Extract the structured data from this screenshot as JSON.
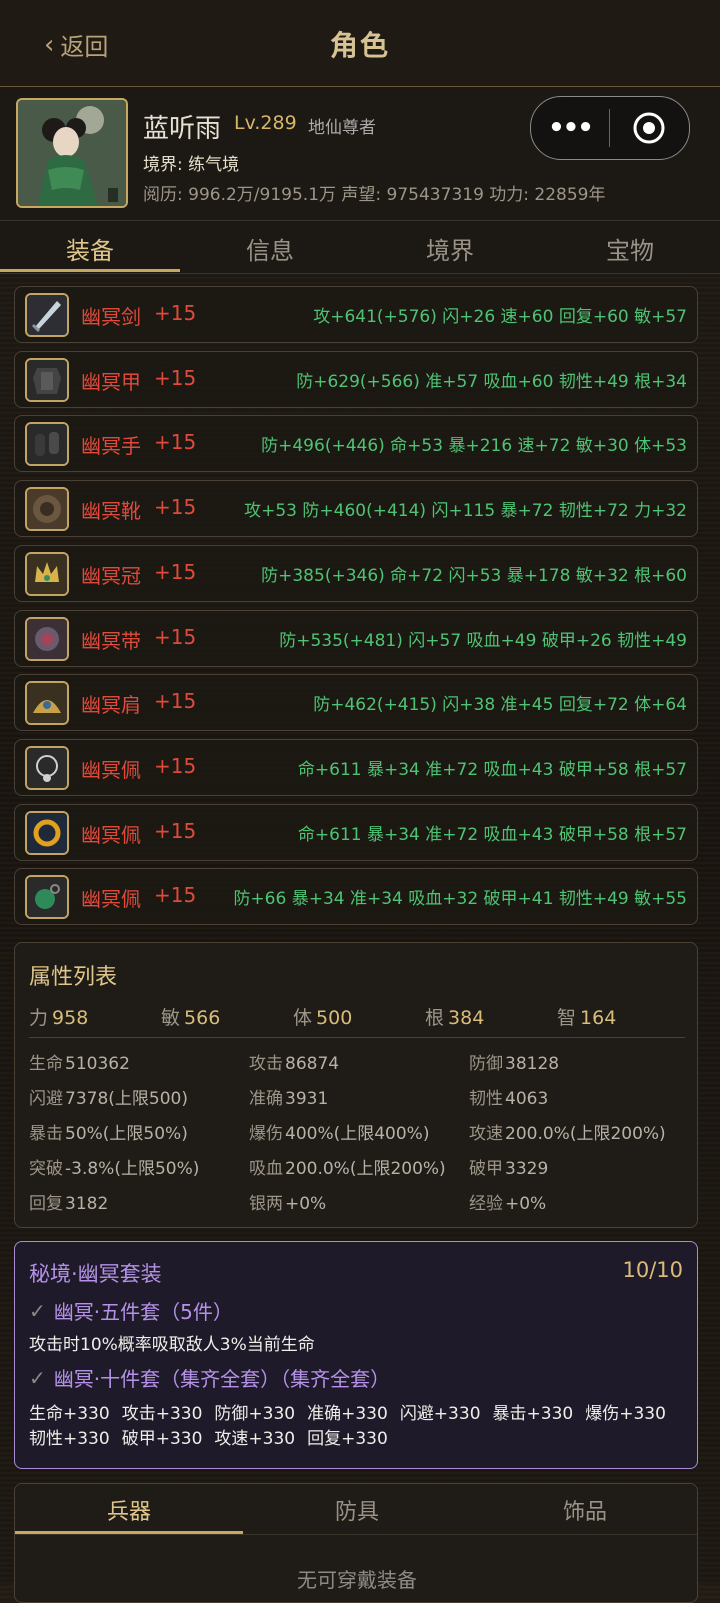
{
  "header": {
    "back_label": "返回",
    "title": "角色"
  },
  "profile": {
    "name": "蓝听雨",
    "level": "Lv.289",
    "rank": "地仙尊者",
    "realm": "境界: 练气境",
    "stats": "阅历: 996.2万/9195.1万   声望: 975437319   功力: 22859年"
  },
  "tabs": [
    "装备",
    "信息",
    "境界",
    "宝物"
  ],
  "equipment": [
    {
      "icon": "sword-icon",
      "name": "幽冥剑",
      "plus": "+15",
      "attrs": "攻+641(+576) 闪+26 速+60 回复+60 敏+57"
    },
    {
      "icon": "armor-icon",
      "name": "幽冥甲",
      "plus": "+15",
      "attrs": "防+629(+566) 准+57 吸血+60 韧性+49 根+34"
    },
    {
      "icon": "gloves-icon",
      "name": "幽冥手",
      "plus": "+15",
      "attrs": "防+496(+446) 命+53 暴+216 速+72 敏+30 体+53"
    },
    {
      "icon": "boots-icon",
      "name": "幽冥靴",
      "plus": "+15",
      "attrs": "攻+53 防+460(+414) 闪+115 暴+72 韧性+72 力+32"
    },
    {
      "icon": "crown-icon",
      "name": "幽冥冠",
      "plus": "+15",
      "attrs": "防+385(+346) 命+72 闪+53 暴+178 敏+32 根+60"
    },
    {
      "icon": "belt-icon",
      "name": "幽冥带",
      "plus": "+15",
      "attrs": "防+535(+481) 闪+57 吸血+49 破甲+26 韧性+49"
    },
    {
      "icon": "shoulder-icon",
      "name": "幽冥肩",
      "plus": "+15",
      "attrs": "防+462(+415) 闪+38 准+45 回复+72 体+64"
    },
    {
      "icon": "necklace-icon",
      "name": "幽冥佩",
      "plus": "+15",
      "attrs": "命+611 暴+34 准+72 吸血+43 破甲+58 根+57"
    },
    {
      "icon": "ring-icon",
      "name": "幽冥佩",
      "plus": "+15",
      "attrs": "命+611 暴+34 准+72 吸血+43 破甲+58 根+57"
    },
    {
      "icon": "jade-pendant-icon",
      "name": "幽冥佩",
      "plus": "+15",
      "attrs": "防+66 暴+34 准+34 吸血+32 破甲+41 韧性+49 敏+55"
    }
  ],
  "attributes": {
    "title": "属性列表",
    "base": [
      {
        "label": "力",
        "value": "958"
      },
      {
        "label": "敏",
        "value": "566"
      },
      {
        "label": "体",
        "value": "500"
      },
      {
        "label": "根",
        "value": "384"
      },
      {
        "label": "智",
        "value": "164"
      }
    ],
    "cells": [
      {
        "label": "生命",
        "value": "510362"
      },
      {
        "label": "攻击",
        "value": "86874"
      },
      {
        "label": "防御",
        "value": "38128"
      },
      {
        "label": "闪避",
        "value": "7378(上限500)"
      },
      {
        "label": "准确",
        "value": "3931"
      },
      {
        "label": "韧性",
        "value": "4063"
      },
      {
        "label": "暴击",
        "value": "50%(上限50%)"
      },
      {
        "label": "爆伤",
        "value": "400%(上限400%)"
      },
      {
        "label": "攻速",
        "value": "200.0%(上限200%)"
      },
      {
        "label": "突破",
        "value": "-3.8%(上限50%)"
      },
      {
        "label": "吸血",
        "value": "200.0%(上限200%)"
      },
      {
        "label": "破甲",
        "value": "3329"
      },
      {
        "label": "回复",
        "value": "3182"
      },
      {
        "label": "银两",
        "value": "+0%"
      },
      {
        "label": "经验",
        "value": "+0%"
      }
    ]
  },
  "set": {
    "title": "秘境·幽冥套装",
    "count": "10/10",
    "five_title": "幽冥·五件套（5件）",
    "five_desc": "攻击时10%概率吸取敌人3%当前生命",
    "ten_title": "幽冥·十件套（集齐全套）（集齐全套）",
    "bonuses_row1": [
      "生命+330",
      "攻击+330",
      "防御+330",
      "准确+330",
      "闪避+330",
      "暴击+330",
      "爆伤+330"
    ],
    "bonuses_row2": [
      "韧性+330",
      "破甲+330",
      "攻速+330",
      "回复+330"
    ]
  },
  "bottom_tabs": [
    "兵器",
    "防具",
    "饰品"
  ],
  "empty_text": "无可穿戴装备",
  "colors": {
    "accent": "#c8a860",
    "equip_name": "#e04a3a",
    "equip_attr": "#4fc374",
    "set_purple": "#b592e8"
  }
}
